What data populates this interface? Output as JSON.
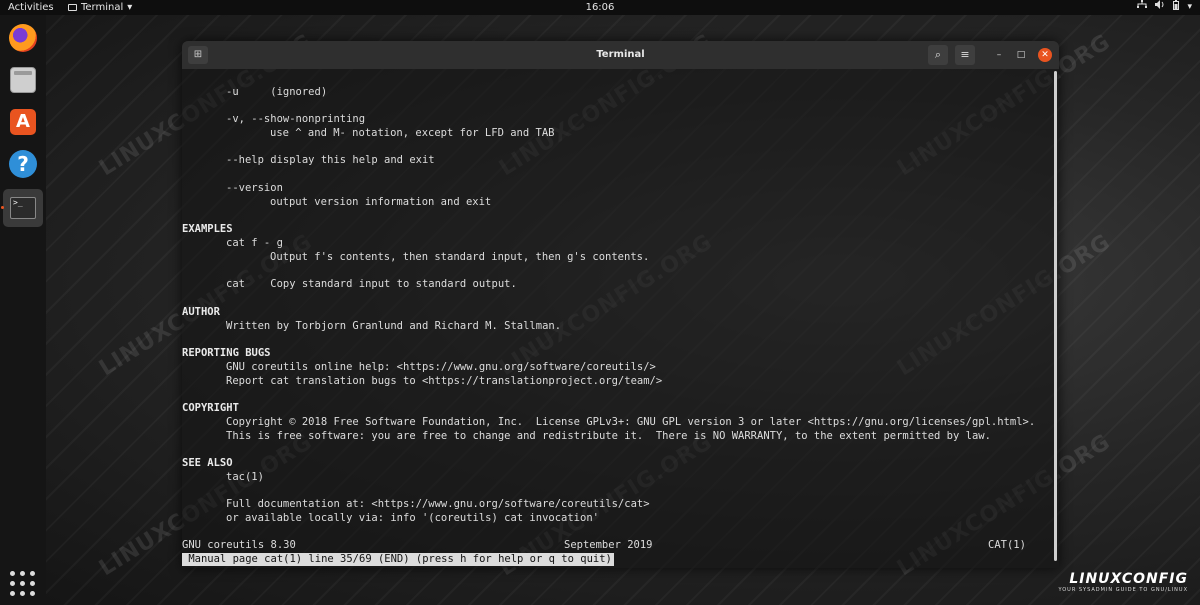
{
  "topbar": {
    "activities": "Activities",
    "app_name": "Terminal",
    "app_arrow": "▾",
    "clock": "16:06",
    "tray": {
      "network_icon": "network-icon",
      "volume_icon": "volume-icon",
      "battery_icon": "battery-icon",
      "arrow": "▾"
    }
  },
  "dock": {
    "items": [
      "firefox-icon",
      "files-icon",
      "software-icon",
      "help-icon",
      "terminal-icon"
    ],
    "software_glyph": "A",
    "help_glyph": "?",
    "terminal_glyph": ">_",
    "apps_grid_icon": "apps-grid-icon"
  },
  "window": {
    "title": "Terminal",
    "search_glyph": "⌕",
    "menu_glyph": "≡",
    "min_glyph": "–",
    "max_glyph": "□",
    "close_glyph": "✕",
    "newtab_glyph": "⊞"
  },
  "terminal": {
    "lines": [
      {
        "indent": 1,
        "text": "-u     (ignored)"
      },
      {
        "indent": 0,
        "text": ""
      },
      {
        "indent": 1,
        "text": "-v, --show-nonprinting"
      },
      {
        "indent": 2,
        "text": "use ^ and M- notation, except for LFD and TAB"
      },
      {
        "indent": 0,
        "text": ""
      },
      {
        "indent": 1,
        "text": "--help display this help and exit"
      },
      {
        "indent": 0,
        "text": ""
      },
      {
        "indent": 1,
        "text": "--version"
      },
      {
        "indent": 2,
        "text": "output version information and exit"
      },
      {
        "indent": 0,
        "text": ""
      },
      {
        "indent": 0,
        "text": "EXAMPLES"
      },
      {
        "indent": 1,
        "text": "cat f - g"
      },
      {
        "indent": 2,
        "text": "Output f's contents, then standard input, then g's contents."
      },
      {
        "indent": 0,
        "text": ""
      },
      {
        "indent": 1,
        "text": "cat    Copy standard input to standard output."
      },
      {
        "indent": 0,
        "text": ""
      },
      {
        "indent": 0,
        "text": "AUTHOR"
      },
      {
        "indent": 1,
        "text": "Written by Torbjorn Granlund and Richard M. Stallman."
      },
      {
        "indent": 0,
        "text": ""
      },
      {
        "indent": 0,
        "text": "REPORTING BUGS"
      },
      {
        "indent": 1,
        "text": "GNU coreutils online help: <https://www.gnu.org/software/coreutils/>"
      },
      {
        "indent": 1,
        "text": "Report cat translation bugs to <https://translationproject.org/team/>"
      },
      {
        "indent": 0,
        "text": ""
      },
      {
        "indent": 0,
        "text": "COPYRIGHT"
      },
      {
        "indent": 1,
        "text": "Copyright © 2018 Free Software Foundation, Inc.  License GPLv3+: GNU GPL version 3 or later <https://gnu.org/licenses/gpl.html>."
      },
      {
        "indent": 1,
        "text": "This is free software: you are free to change and redistribute it.  There is NO WARRANTY, to the extent permitted by law."
      },
      {
        "indent": 0,
        "text": ""
      },
      {
        "indent": 0,
        "text": "SEE ALSO"
      },
      {
        "indent": 1,
        "text": "tac(1)"
      },
      {
        "indent": 0,
        "text": ""
      },
      {
        "indent": 1,
        "text": "Full documentation at: <https://www.gnu.org/software/coreutils/cat>"
      },
      {
        "indent": 1,
        "text": "or available locally via: info '(coreutils) cat invocation'"
      },
      {
        "indent": 0,
        "text": ""
      },
      {
        "indent": 0,
        "text": ""
      }
    ],
    "footer": {
      "left": "GNU coreutils 8.30",
      "center": "September 2019",
      "right": "CAT(1)"
    },
    "status": " Manual page cat(1) line 35/69 (END) (press h for help or q to quit)"
  },
  "watermark": "LINUXCONFIG.ORG",
  "brand": {
    "name": "LINUXCONFIG",
    "tagline": "YOUR SYSADMIN GUIDE TO GNU/LINUX"
  }
}
